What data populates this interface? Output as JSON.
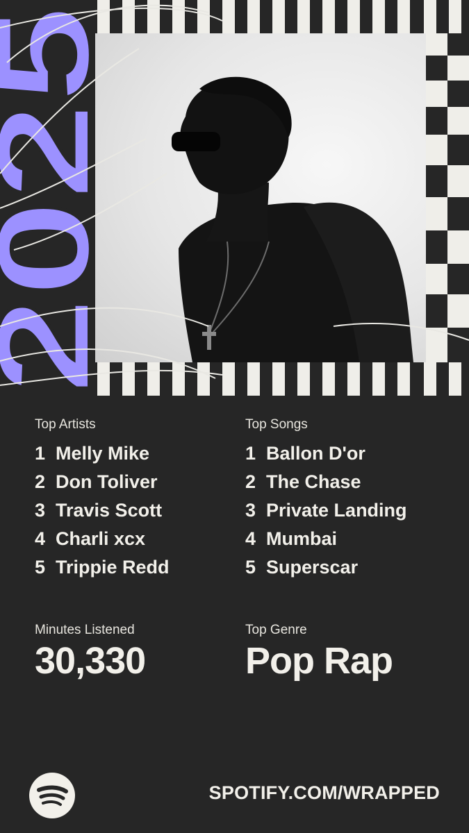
{
  "hero": {
    "year": "2025"
  },
  "top_artists": {
    "label": "Top Artists",
    "items": [
      {
        "rank": "1",
        "name": "Melly Mike"
      },
      {
        "rank": "2",
        "name": "Don Toliver"
      },
      {
        "rank": "3",
        "name": "Travis Scott"
      },
      {
        "rank": "4",
        "name": "Charli xcx"
      },
      {
        "rank": "5",
        "name": "Trippie Redd"
      }
    ]
  },
  "top_songs": {
    "label": "Top Songs",
    "items": [
      {
        "rank": "1",
        "name": "Ballon D'or"
      },
      {
        "rank": "2",
        "name": "The Chase"
      },
      {
        "rank": "3",
        "name": "Private Landing"
      },
      {
        "rank": "4",
        "name": "Mumbai"
      },
      {
        "rank": "5",
        "name": "Superscar"
      }
    ]
  },
  "stats": {
    "minutes_label": "Minutes Listened",
    "minutes_value": "30,330",
    "genre_label": "Top Genre",
    "genre_value": "Pop Rap"
  },
  "footer": {
    "url": "SPOTIFY.COM/WRAPPED",
    "logo_icon": "spotify-logo-icon"
  },
  "colors": {
    "background": "#262626",
    "text": "#f2f0ea",
    "accent": "#9c91ff"
  }
}
